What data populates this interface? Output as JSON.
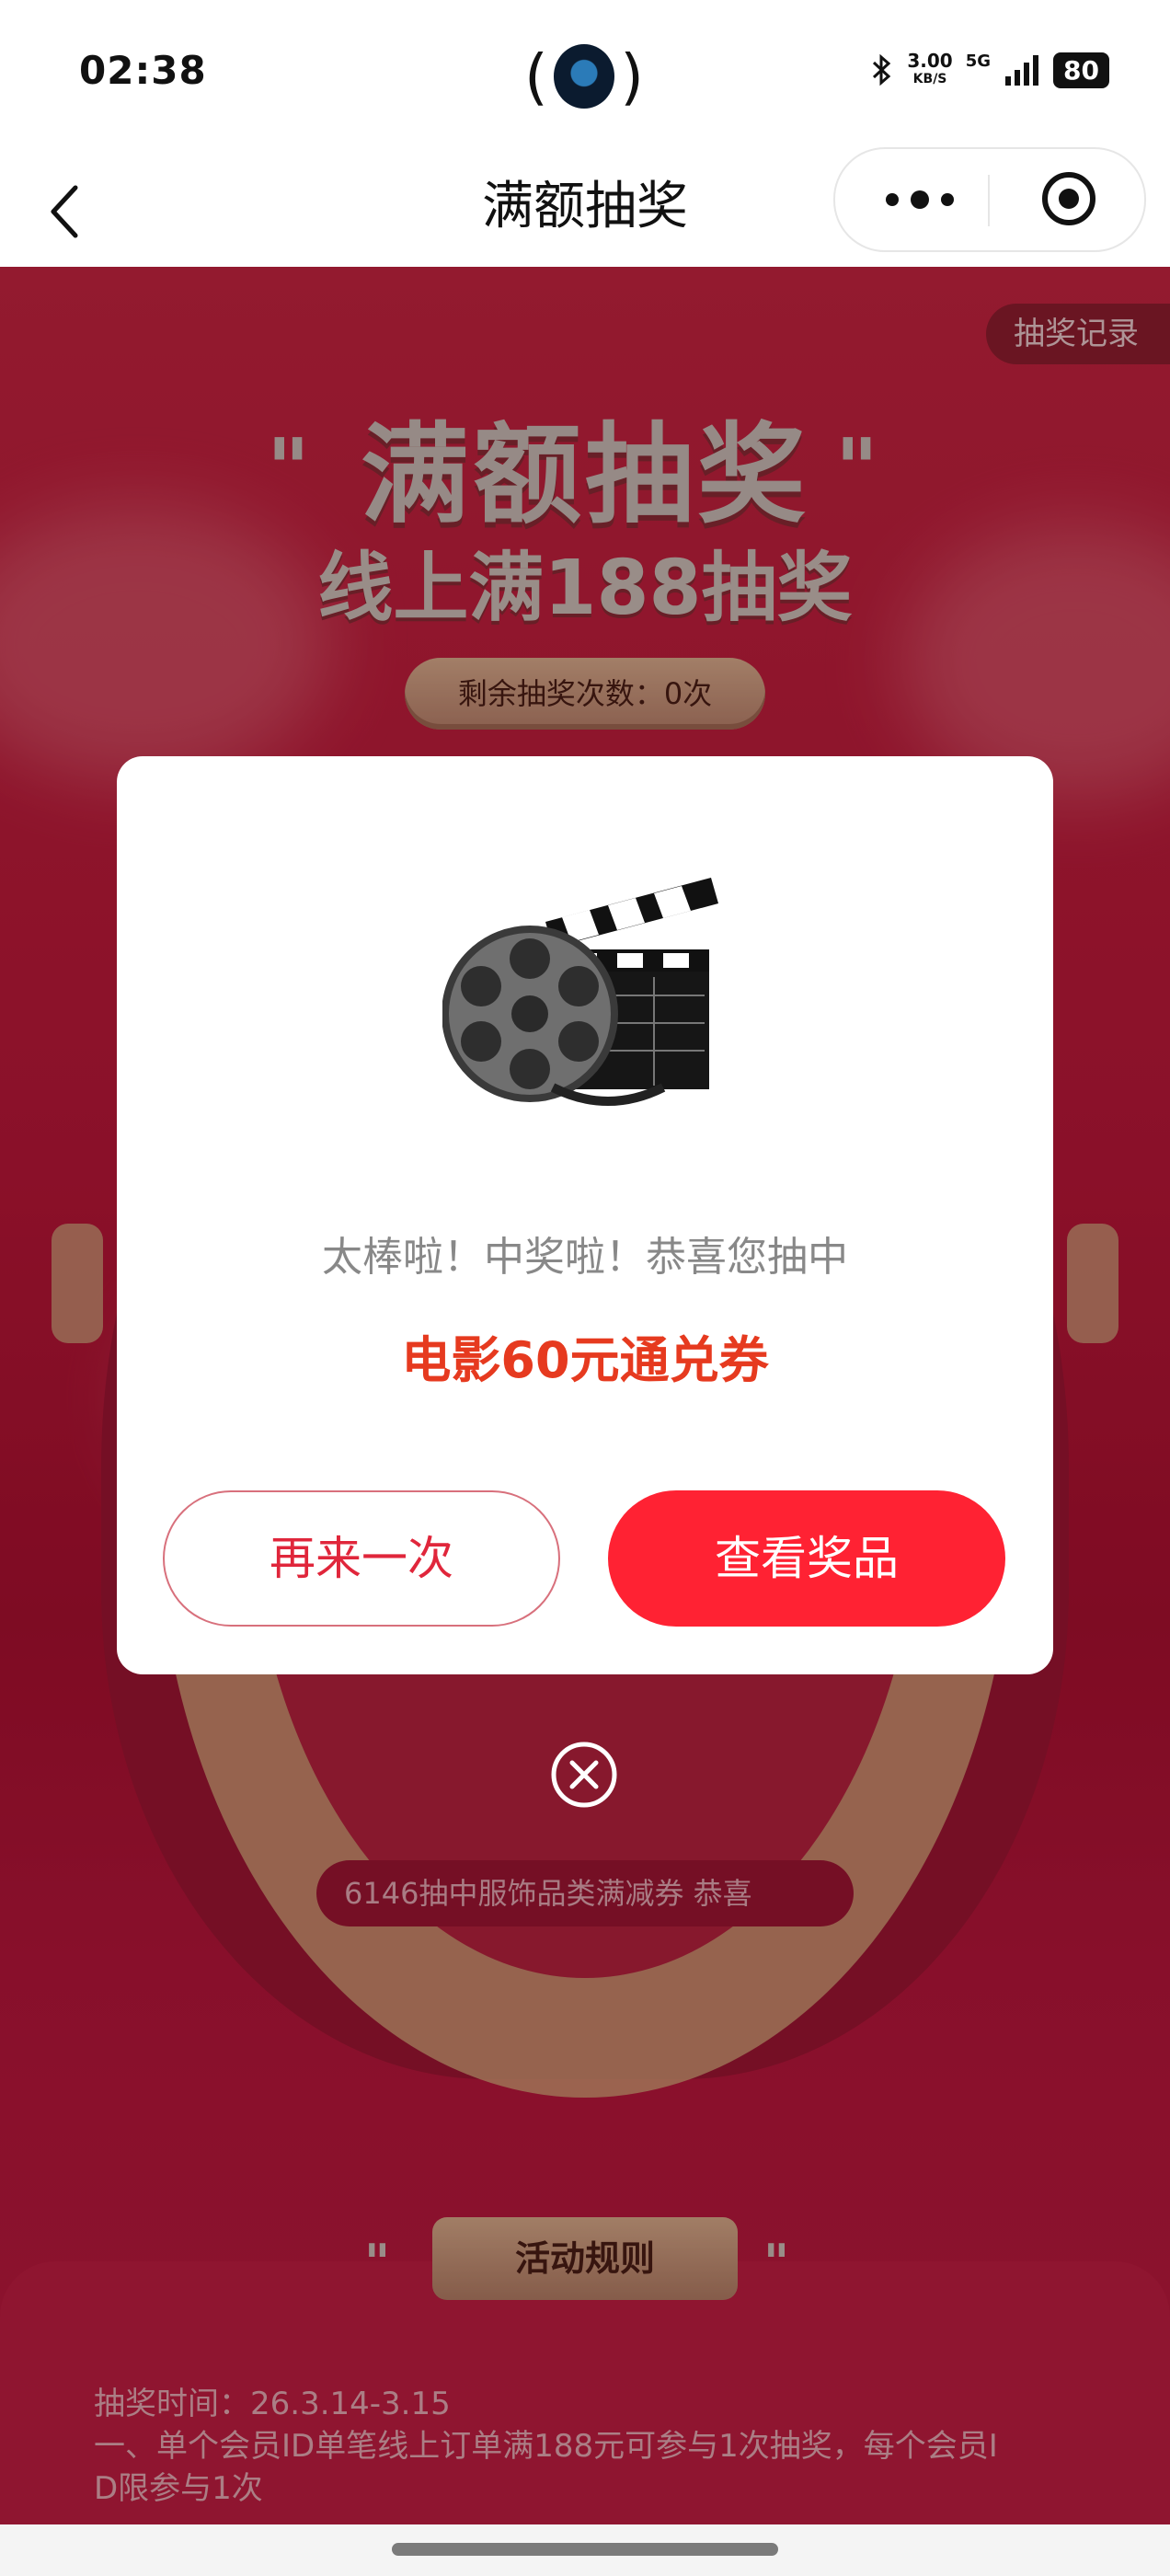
{
  "status_bar": {
    "time": "02:38",
    "center_open": "(",
    "center_close": ")",
    "speed_value": "3.00",
    "speed_unit": "KB/S",
    "network": "5G",
    "battery": "80",
    "icons": [
      "bluetooth-icon",
      "signal-icon",
      "battery-icon"
    ]
  },
  "nav": {
    "title": "满额抽奖",
    "back_icon": "chevron-left-icon",
    "more_icon": "more-dots-icon",
    "close_icon": "target-icon"
  },
  "page": {
    "record_label": "抽奖记录",
    "big_title": "满额抽奖",
    "sub_title": "线上满188抽奖",
    "remaining_label": "剩余抽奖次数：0次",
    "ticker_text": "6146抽中服饰品类满减券      恭喜",
    "rules_label": "活动规则",
    "rules": [
      "抽奖时间：26.3.14-3.15",
      "一、单个会员ID单笔线上订单满188元可参与1次抽奖，每个会员I",
      "D限参与1次"
    ]
  },
  "modal": {
    "prize_icon": "film-reel-clapperboard-icon",
    "message": "太棒啦！中奖啦！恭喜您抽中",
    "prize_name": "电影60元通兑券",
    "again_button": "再来一次",
    "view_button": "查看奖品",
    "close_icon": "close-circle-icon"
  },
  "colors": {
    "brand_red": "#ff2233",
    "prize_orange": "#e63a1f",
    "page_red": "#b91637"
  }
}
